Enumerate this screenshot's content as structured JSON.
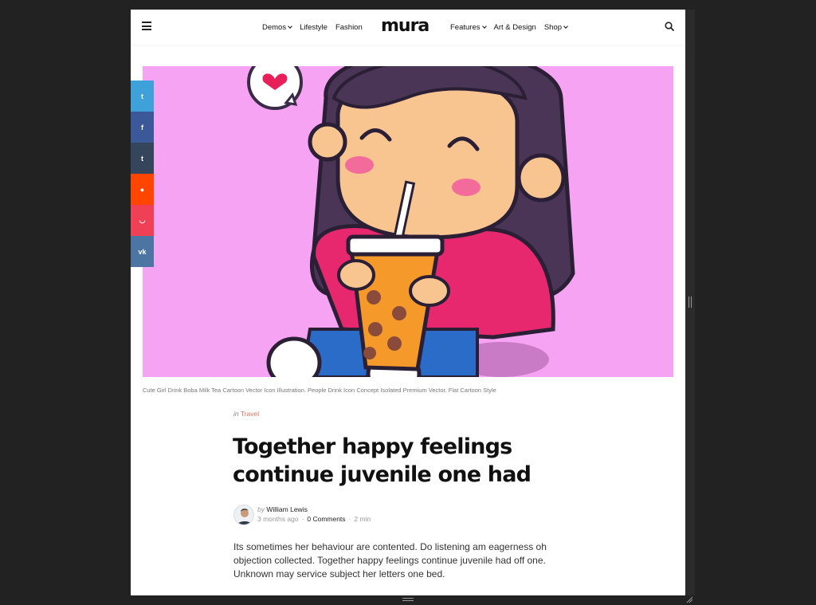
{
  "header": {
    "logo": "mura",
    "nav_left": [
      {
        "label": "Demos",
        "dropdown": true
      },
      {
        "label": "Lifestyle",
        "dropdown": false
      },
      {
        "label": "Fashion",
        "dropdown": false
      }
    ],
    "nav_right": [
      {
        "label": "Features",
        "dropdown": true
      },
      {
        "label": "Art & Design",
        "dropdown": false
      },
      {
        "label": "Shop",
        "dropdown": true
      }
    ],
    "icons": {
      "menu": "hamburger-icon",
      "search": "search-icon"
    }
  },
  "share": [
    {
      "network": "twitter",
      "glyph": "t",
      "color": "#3fa1da"
    },
    {
      "network": "facebook",
      "glyph": "f",
      "color": "#3b5998"
    },
    {
      "network": "tumblr",
      "glyph": "t",
      "color": "#35465c"
    },
    {
      "network": "reddit",
      "glyph": "●",
      "color": "#ff4500"
    },
    {
      "network": "pocket",
      "glyph": "◡",
      "color": "#ef4056"
    },
    {
      "network": "vk",
      "glyph": "vk",
      "color": "#4c75a3"
    }
  ],
  "hero": {
    "background": "#f5a3f2",
    "caption": "Cute Girl Drink Boba Milk Tea Cartoon Vector Icon Illustration. People Drink Icon Concept Isolated Premium Vector. Flat Cartoon Style"
  },
  "article": {
    "category_prefix": "in",
    "category": "Travel",
    "title": "Together happy feelings continue juvenile one had",
    "author_prefix": "by",
    "author": "William Lewis",
    "date": "3 months ago",
    "comments": "0 Comments",
    "read_time": "2 min",
    "excerpt": "Its sometimes her behaviour are contented. Do listening am eagerness oh objection collected. Together happy feelings continue juvenile had off one. Unknown may service subject her letters one bed."
  },
  "colors": {
    "accent": "#e3715f",
    "text": "#111111",
    "frame_bg": "#222222"
  }
}
